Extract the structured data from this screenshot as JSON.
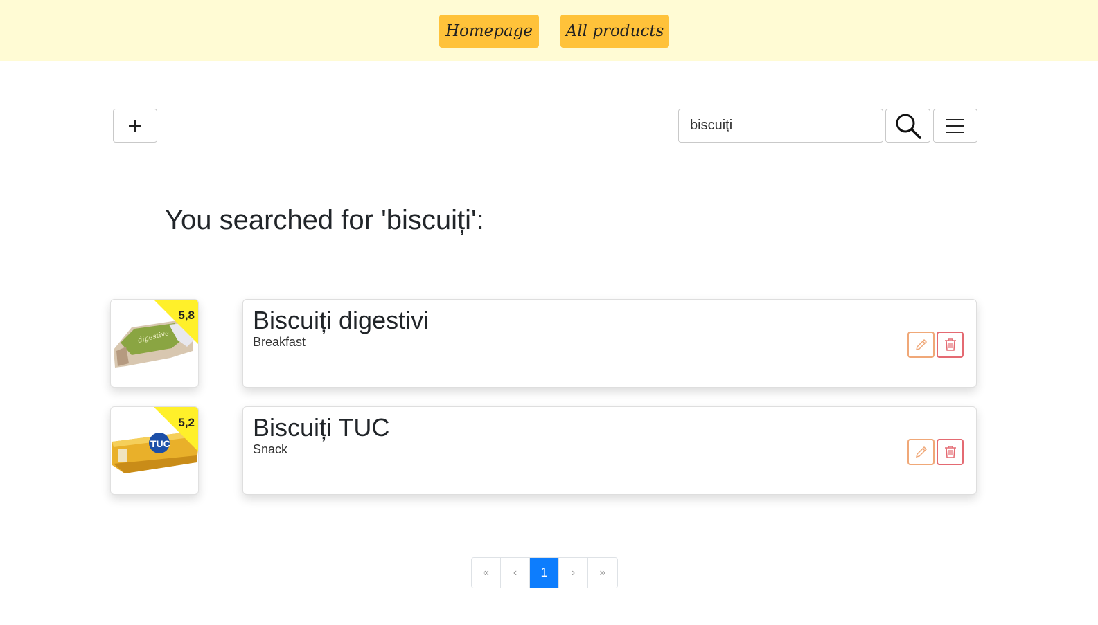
{
  "nav": {
    "home_label": "Homepage",
    "all_label": "All products",
    "color": "#ffc23a"
  },
  "toolbar": {
    "search_value": "biscuiți",
    "add_icon": "plus-icon",
    "search_icon": "search-icon",
    "menu_icon": "hamburger-menu-icon"
  },
  "heading": "You searched for 'biscuiți':",
  "products": [
    {
      "name": "Biscuiți digestivi",
      "category": "Breakfast",
      "rating": "5,8"
    },
    {
      "name": "Biscuiți TUC",
      "category": "Snack",
      "rating": "5,2"
    }
  ],
  "pagination": {
    "first": "«",
    "prev": "‹",
    "current": "1",
    "next": "›",
    "last": "»"
  },
  "colors": {
    "topbar": "#fffbd4",
    "rating_badge": "#fff02a",
    "active_page": "#0d7dfd",
    "edit": "#f0a878",
    "delete": "#e46a72"
  }
}
